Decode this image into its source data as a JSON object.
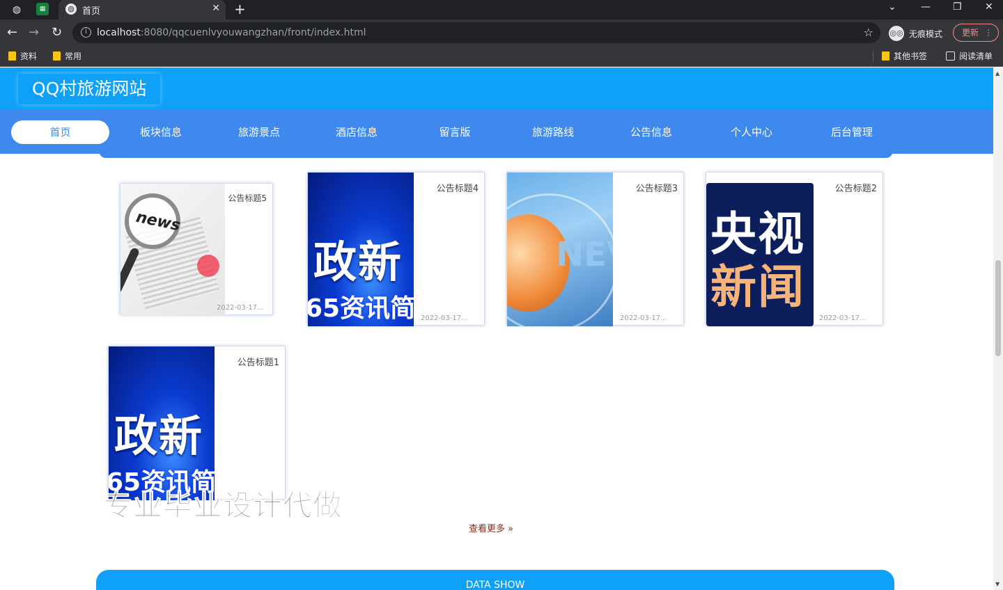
{
  "browser": {
    "tab_title": "首页",
    "url_host": "localhost",
    "url_rest": ":8080/qqcuenlvyouwangzhan/front/index.html",
    "incognito_label": "无痕模式",
    "update_label": "更新",
    "bookmarks": [
      "资料",
      "常用"
    ],
    "bookmarks_right": [
      "其他书签",
      "阅读清单"
    ]
  },
  "site": {
    "title": "QQ村旅游网站",
    "nav": [
      "首页",
      "板块信息",
      "旅游景点",
      "酒店信息",
      "留言版",
      "旅游路线",
      "公告信息",
      "个人中心",
      "后台管理"
    ],
    "active_nav_index": 0
  },
  "announcements": [
    {
      "title": "公告标题5",
      "date": "2022-03-17...",
      "image_text": "news"
    },
    {
      "title": "公告标题4",
      "date": "2022-03-17...",
      "image_text": "政新",
      "image_subtext": "65资讯简"
    },
    {
      "title": "公告标题3",
      "date": "2022-03-17...",
      "image_text": "NEV"
    },
    {
      "title": "公告标题2",
      "date": "2022-03-17...",
      "image_text": "央视",
      "image_subtext": "新闻"
    },
    {
      "title": "公告标题1",
      "date": "",
      "image_text": "政新",
      "image_subtext": "65资讯简"
    }
  ],
  "watermark": "专业毕业设计代做",
  "more_label": "查看更多",
  "data_show_label": "DATA SHOW",
  "colors": {
    "header": "#0ea1f7",
    "nav": "#3f88ee",
    "more_link": "#8a2b1b"
  }
}
